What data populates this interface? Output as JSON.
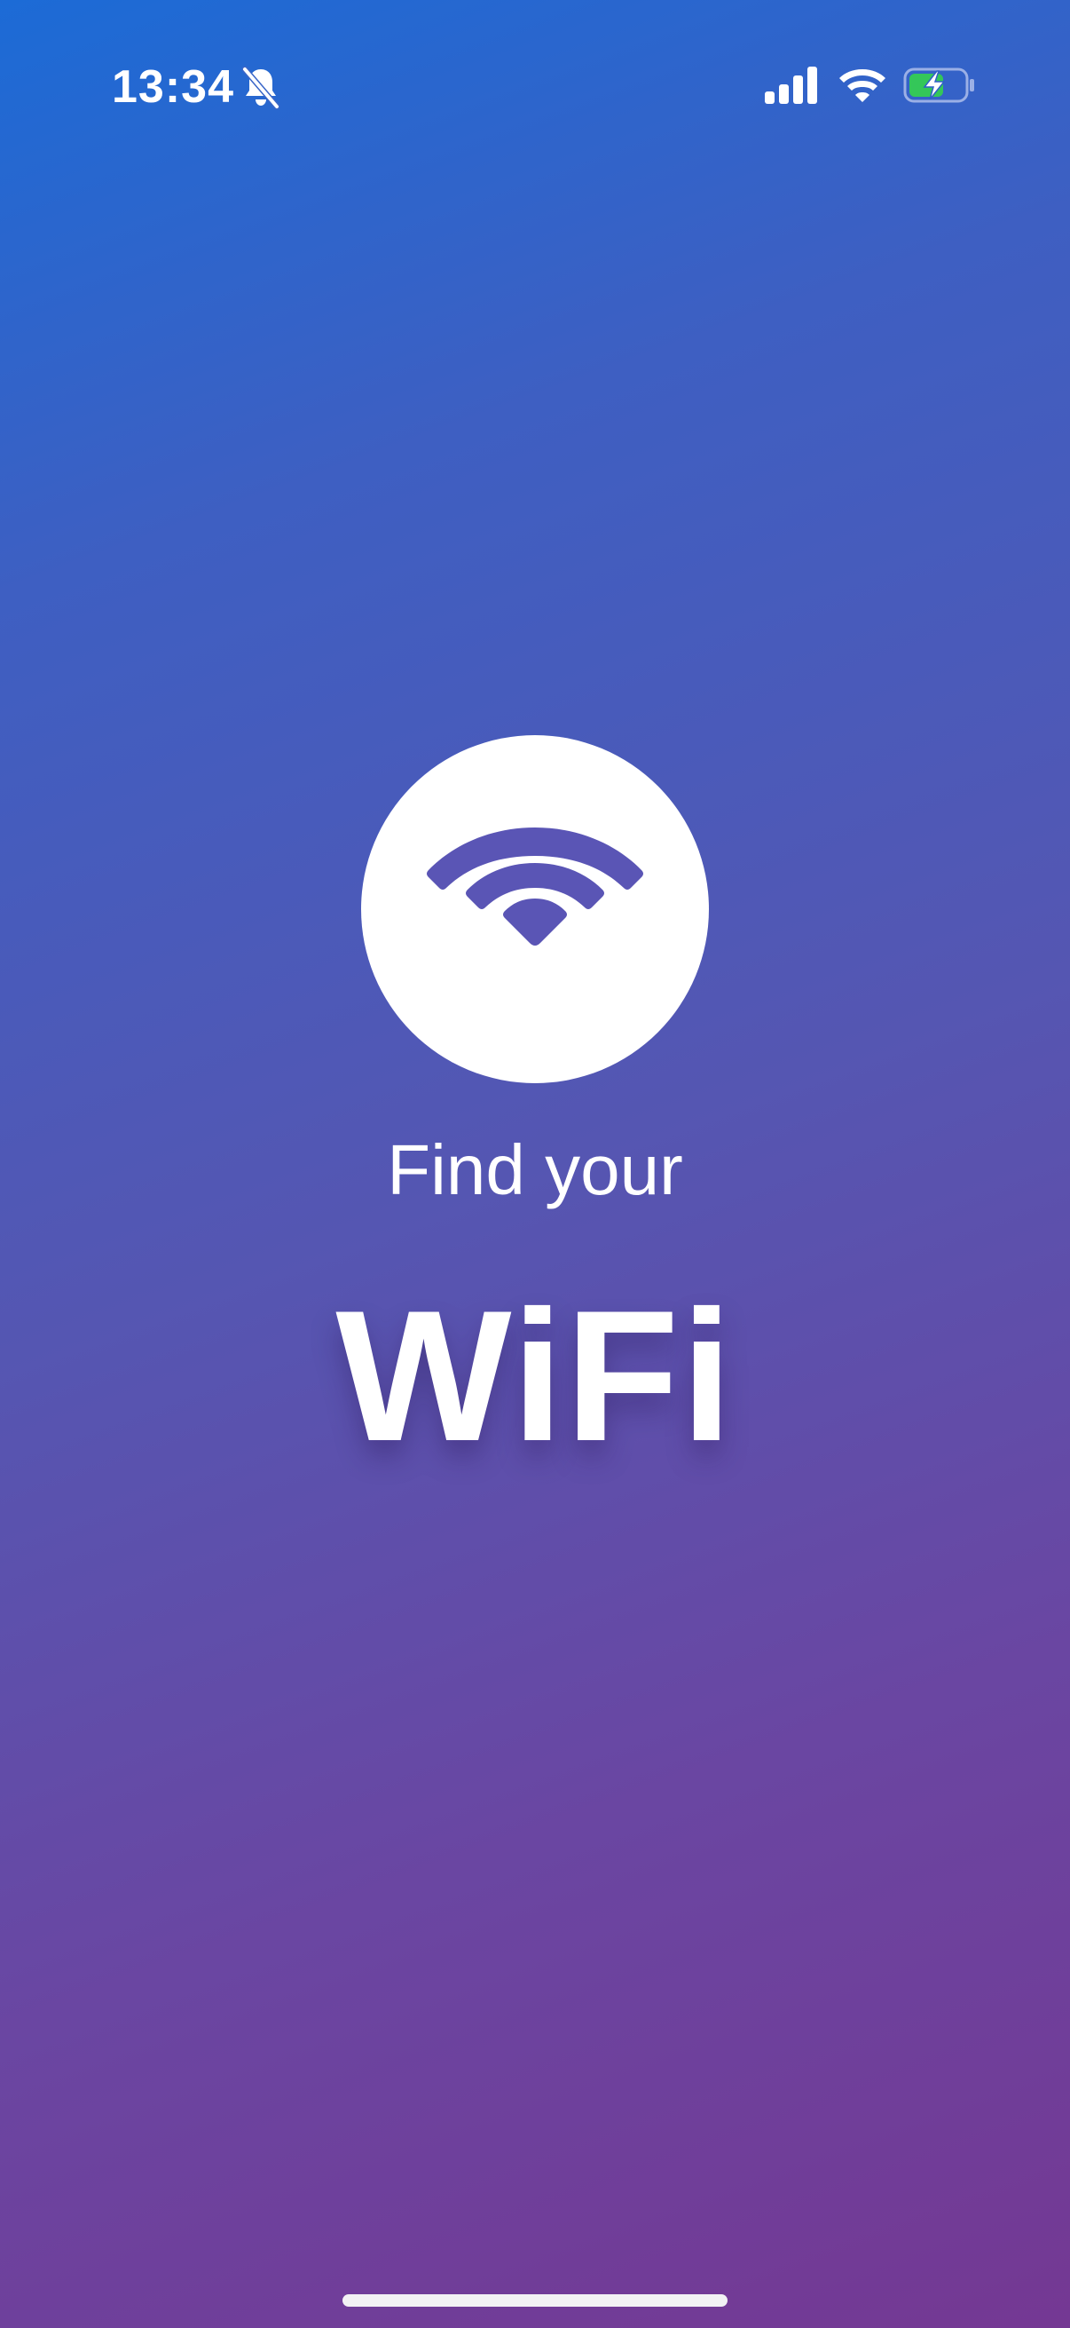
{
  "status_bar": {
    "time": "13:34",
    "icons": [
      "bell-slash-icon",
      "cellular-signal-icon",
      "wifi-icon",
      "battery-charging-icon"
    ],
    "battery_color": "#34c759"
  },
  "splash": {
    "logo_icon": "wifi-icon",
    "subtitle": "Find your",
    "title": "WiFi",
    "accent_color": "#5a55b5"
  }
}
